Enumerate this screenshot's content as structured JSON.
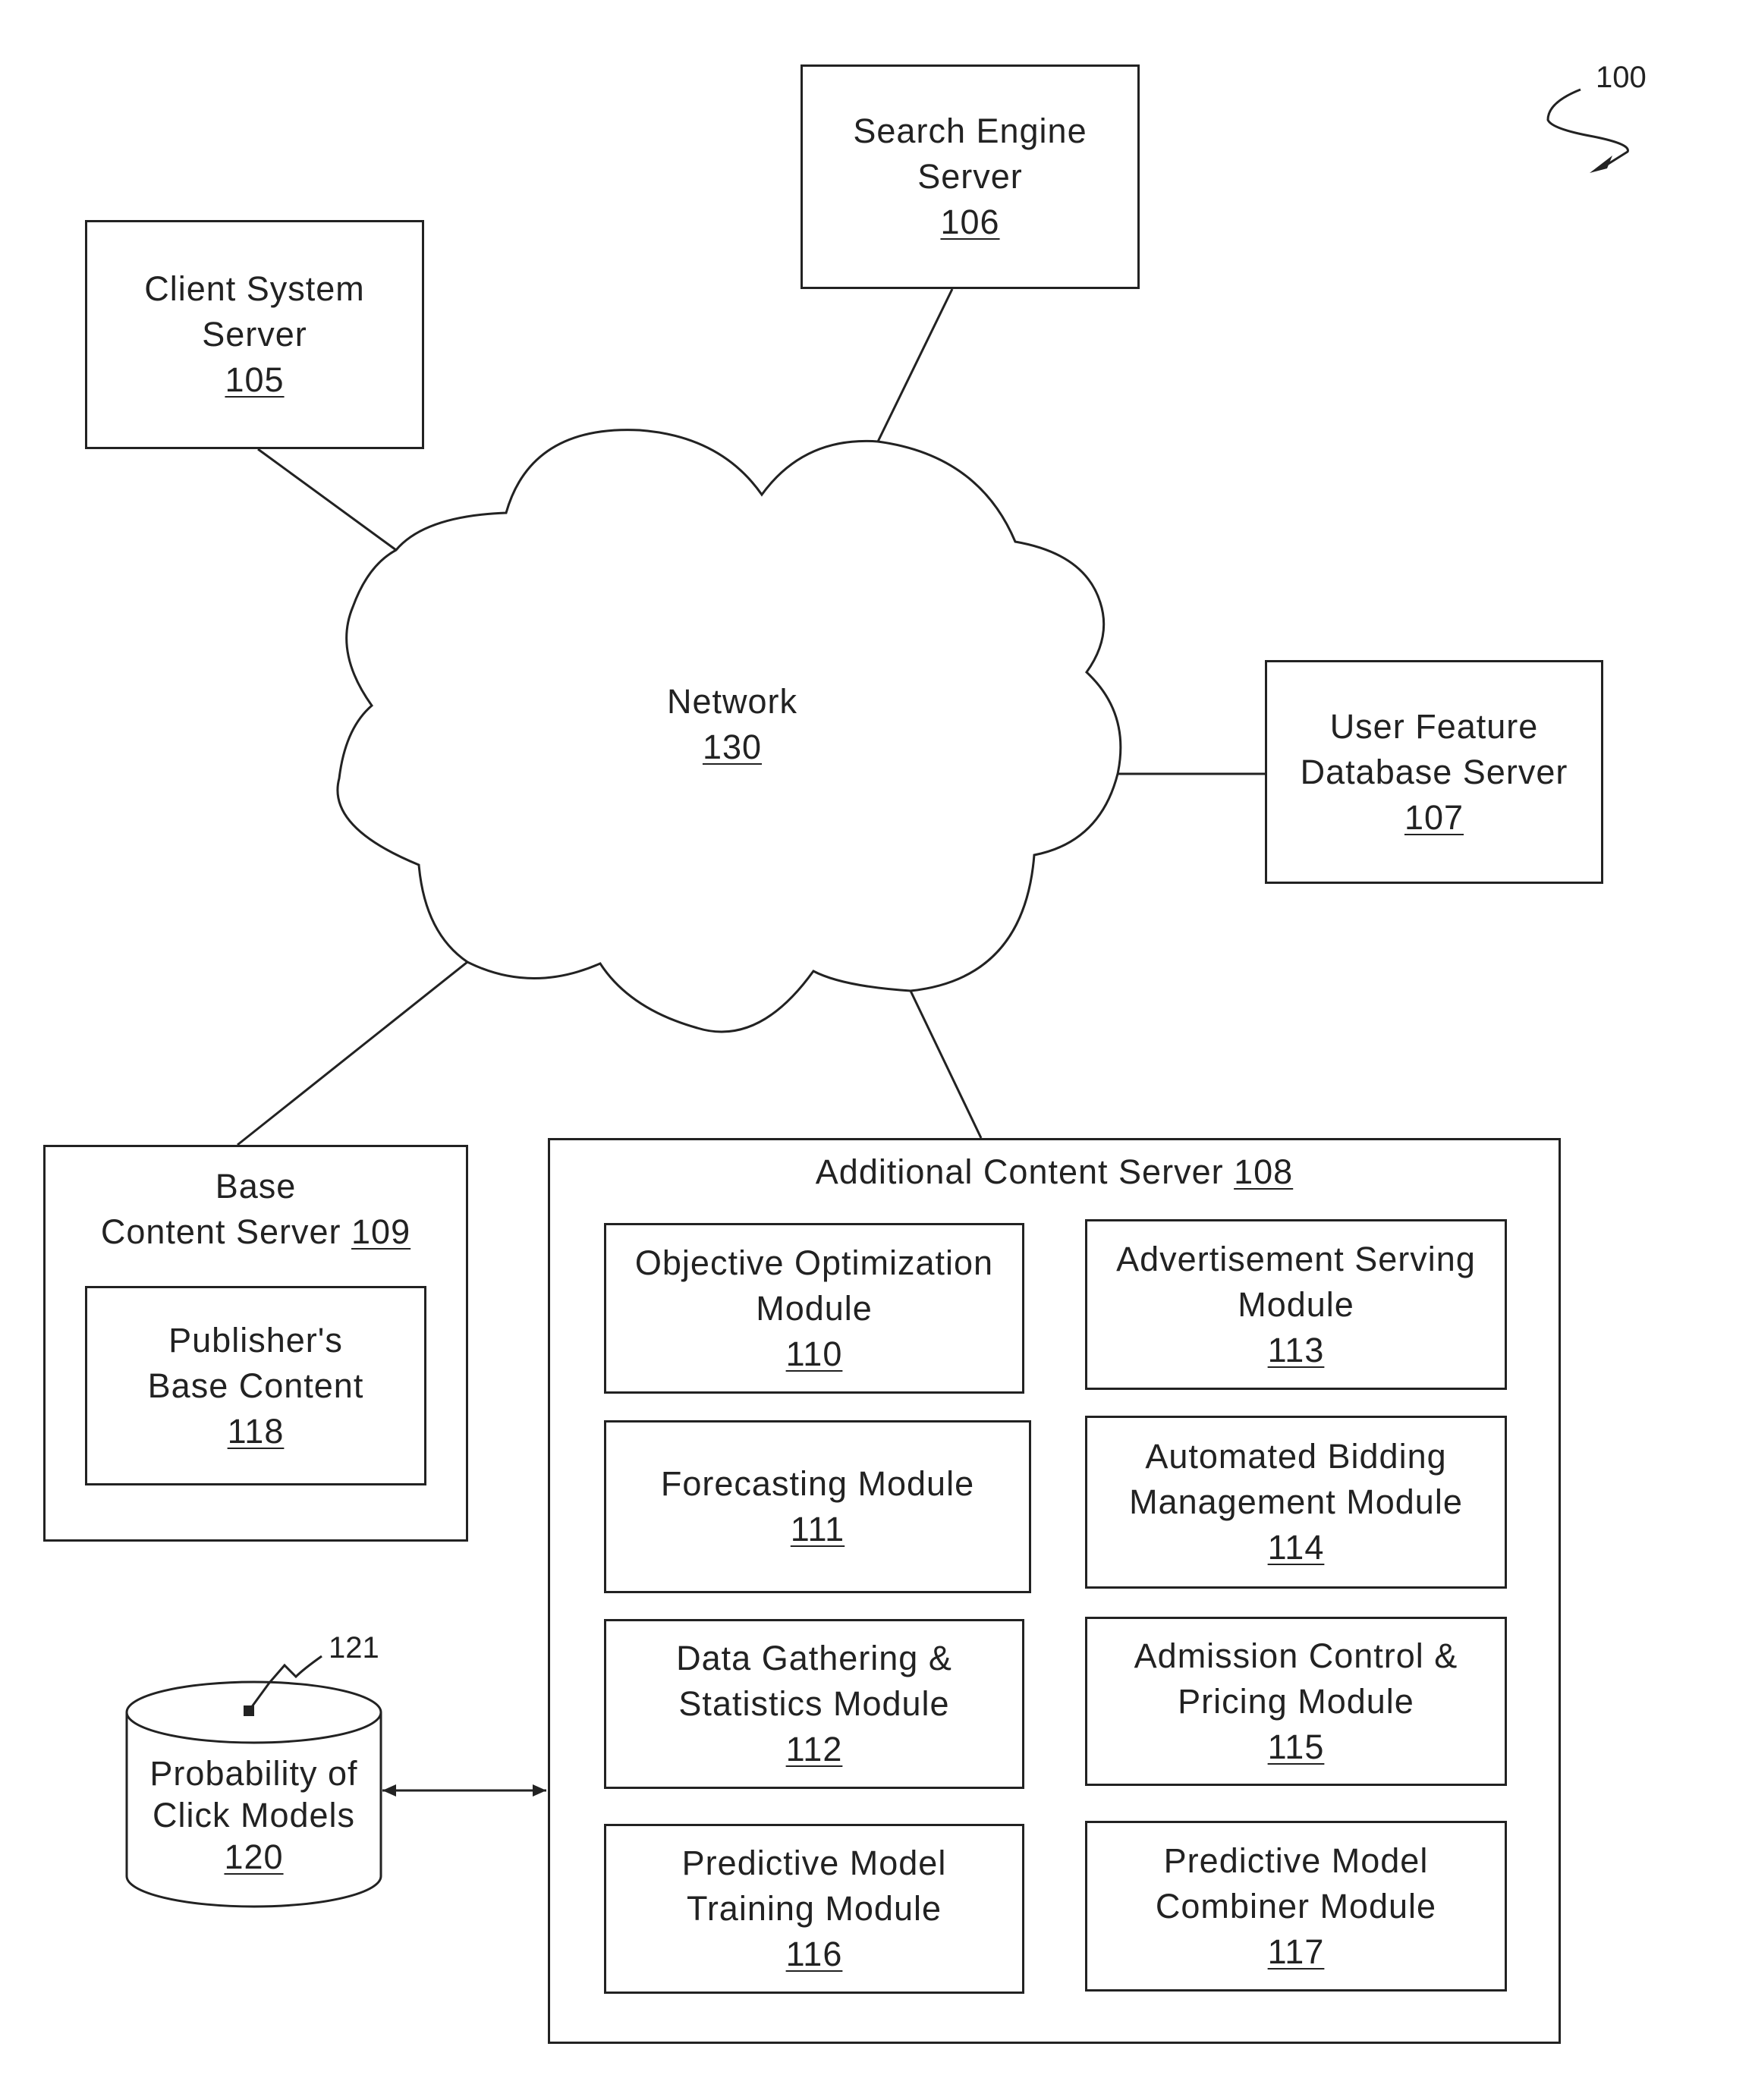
{
  "figure": {
    "ref_number": "100",
    "colors": {
      "line": "#222222",
      "background": "#ffffff"
    }
  },
  "network": {
    "name": "Network",
    "ref": "130"
  },
  "nodes": {
    "search_engine": {
      "lines": [
        "Search Engine",
        "Server"
      ],
      "ref": "106"
    },
    "client_system": {
      "lines": [
        "Client System",
        "Server"
      ],
      "ref": "105"
    },
    "user_feature_db": {
      "lines": [
        "User Feature",
        "Database Server"
      ],
      "ref": "107"
    },
    "base_content_server": {
      "lines": [
        "Base",
        "Content Server"
      ],
      "ref": "109",
      "inner": {
        "lines": [
          "Publisher's",
          "Base Content"
        ],
        "ref": "118"
      }
    },
    "additional_content_server": {
      "title": "Additional Content Server",
      "ref": "108",
      "modules": [
        {
          "lines": [
            "Objective Optimization",
            "Module"
          ],
          "ref": "110"
        },
        {
          "lines": [
            "Advertisement Serving",
            "Module"
          ],
          "ref": "113"
        },
        {
          "lines": [
            "Forecasting Module"
          ],
          "ref": "111"
        },
        {
          "lines": [
            "Automated Bidding",
            "Management Module"
          ],
          "ref": "114"
        },
        {
          "lines": [
            "Data Gathering &",
            "Statistics Module"
          ],
          "ref": "112"
        },
        {
          "lines": [
            "Admission Control &",
            "Pricing Module"
          ],
          "ref": "115"
        },
        {
          "lines": [
            "Predictive Model",
            "Training Module"
          ],
          "ref": "116"
        },
        {
          "lines": [
            "Predictive Model",
            "Combiner Module"
          ],
          "ref": "117"
        }
      ]
    },
    "click_models_db": {
      "lines": [
        "Probability of",
        "Click Models"
      ],
      "ref": "120",
      "callout_ref": "121"
    }
  }
}
